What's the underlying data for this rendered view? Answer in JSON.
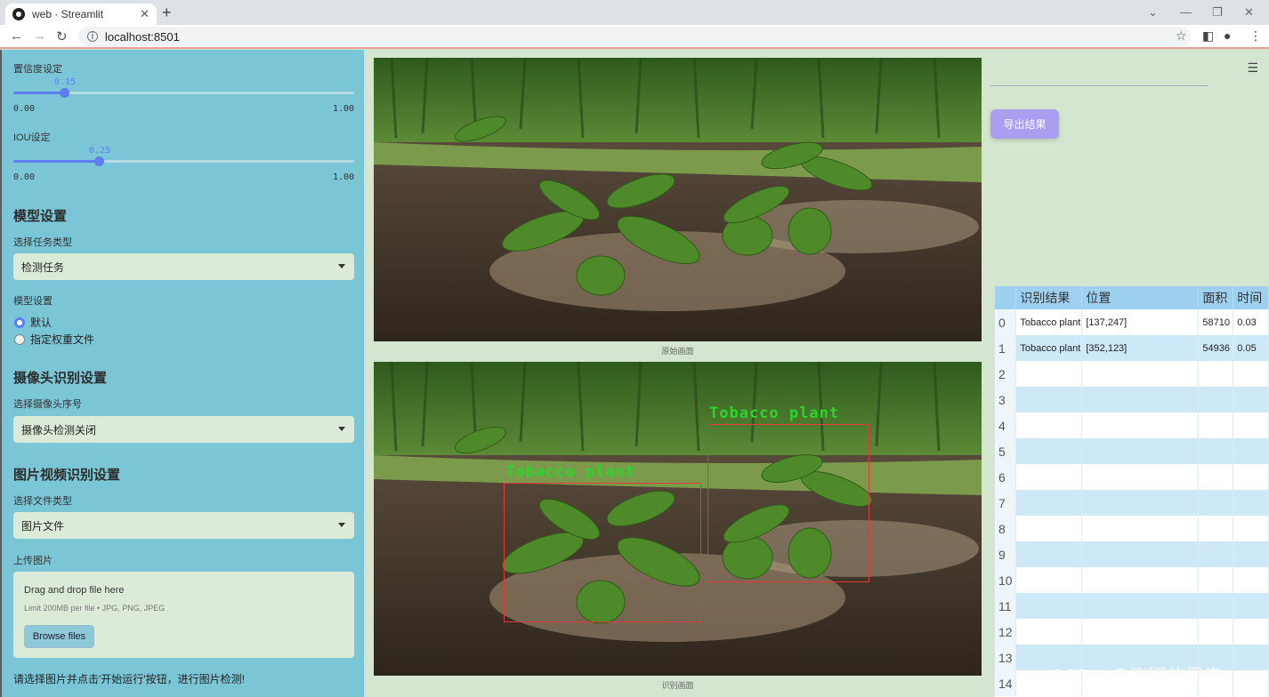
{
  "browser": {
    "tab_title": "web · Streamlit",
    "url": "localhost:8501"
  },
  "sidebar": {
    "conf_label": "置信度设定",
    "conf_value": "0.15",
    "conf_fraction": 0.15,
    "conf_min": "0.00",
    "conf_max": "1.00",
    "iou_label": "IOU设定",
    "iou_value": "0.25",
    "iou_fraction": 0.25,
    "iou_min": "0.00",
    "iou_max": "1.00",
    "model_heading": "模型设置",
    "task_label": "选择任务类型",
    "task_value": "检测任务",
    "model_label": "模型设置",
    "radio_default": "默认",
    "radio_custom": "指定权重文件",
    "camera_heading": "摄像头识别设置",
    "camera_label": "选择摄像头序号",
    "camera_value": "摄像头检测关闭",
    "media_heading": "图片视频识别设置",
    "filetype_label": "选择文件类型",
    "filetype_value": "图片文件",
    "upload_label": "上传图片",
    "drag_text": "Drag and drop file here",
    "limit_text": "Limit 200MB per file • JPG, PNG, JPEG",
    "browse_label": "Browse files",
    "hint": "请选择图片并点击'开始运行'按钮，进行图片检测!"
  },
  "main": {
    "original_caption": "原始画面",
    "detected_caption": "识别画面",
    "export_label": "导出结果",
    "detections": [
      {
        "label": "Tobacco plant"
      },
      {
        "label": "Tobacco plant"
      }
    ]
  },
  "table": {
    "headers": [
      "",
      "识别结果",
      "位置",
      "面积",
      "时间"
    ],
    "rows": [
      [
        "0",
        "Tobacco plant",
        "[137,247]",
        "58710",
        "0.03"
      ],
      [
        "1",
        "Tobacco plant",
        "[352,123]",
        "54936",
        "0.05"
      ],
      [
        "2",
        "",
        "",
        "",
        ""
      ],
      [
        "3",
        "",
        "",
        "",
        ""
      ],
      [
        "4",
        "",
        "",
        "",
        ""
      ],
      [
        "5",
        "",
        "",
        "",
        ""
      ],
      [
        "6",
        "",
        "",
        "",
        ""
      ],
      [
        "7",
        "",
        "",
        "",
        ""
      ],
      [
        "8",
        "",
        "",
        "",
        ""
      ],
      [
        "9",
        "",
        "",
        "",
        ""
      ],
      [
        "10",
        "",
        "",
        "",
        ""
      ],
      [
        "11",
        "",
        "",
        "",
        ""
      ],
      [
        "12",
        "",
        "",
        "",
        ""
      ],
      [
        "13",
        "",
        "",
        "",
        ""
      ],
      [
        "14",
        "",
        "",
        "",
        ""
      ]
    ]
  },
  "watermark": "CSDN @飞翔的佩奇",
  "colors": {
    "sidebar": "#7bc6d6",
    "accent": "#5f7df3",
    "export_button": "#a99ef0",
    "box": "#e23a3a",
    "box_label": "#2bd52b"
  }
}
